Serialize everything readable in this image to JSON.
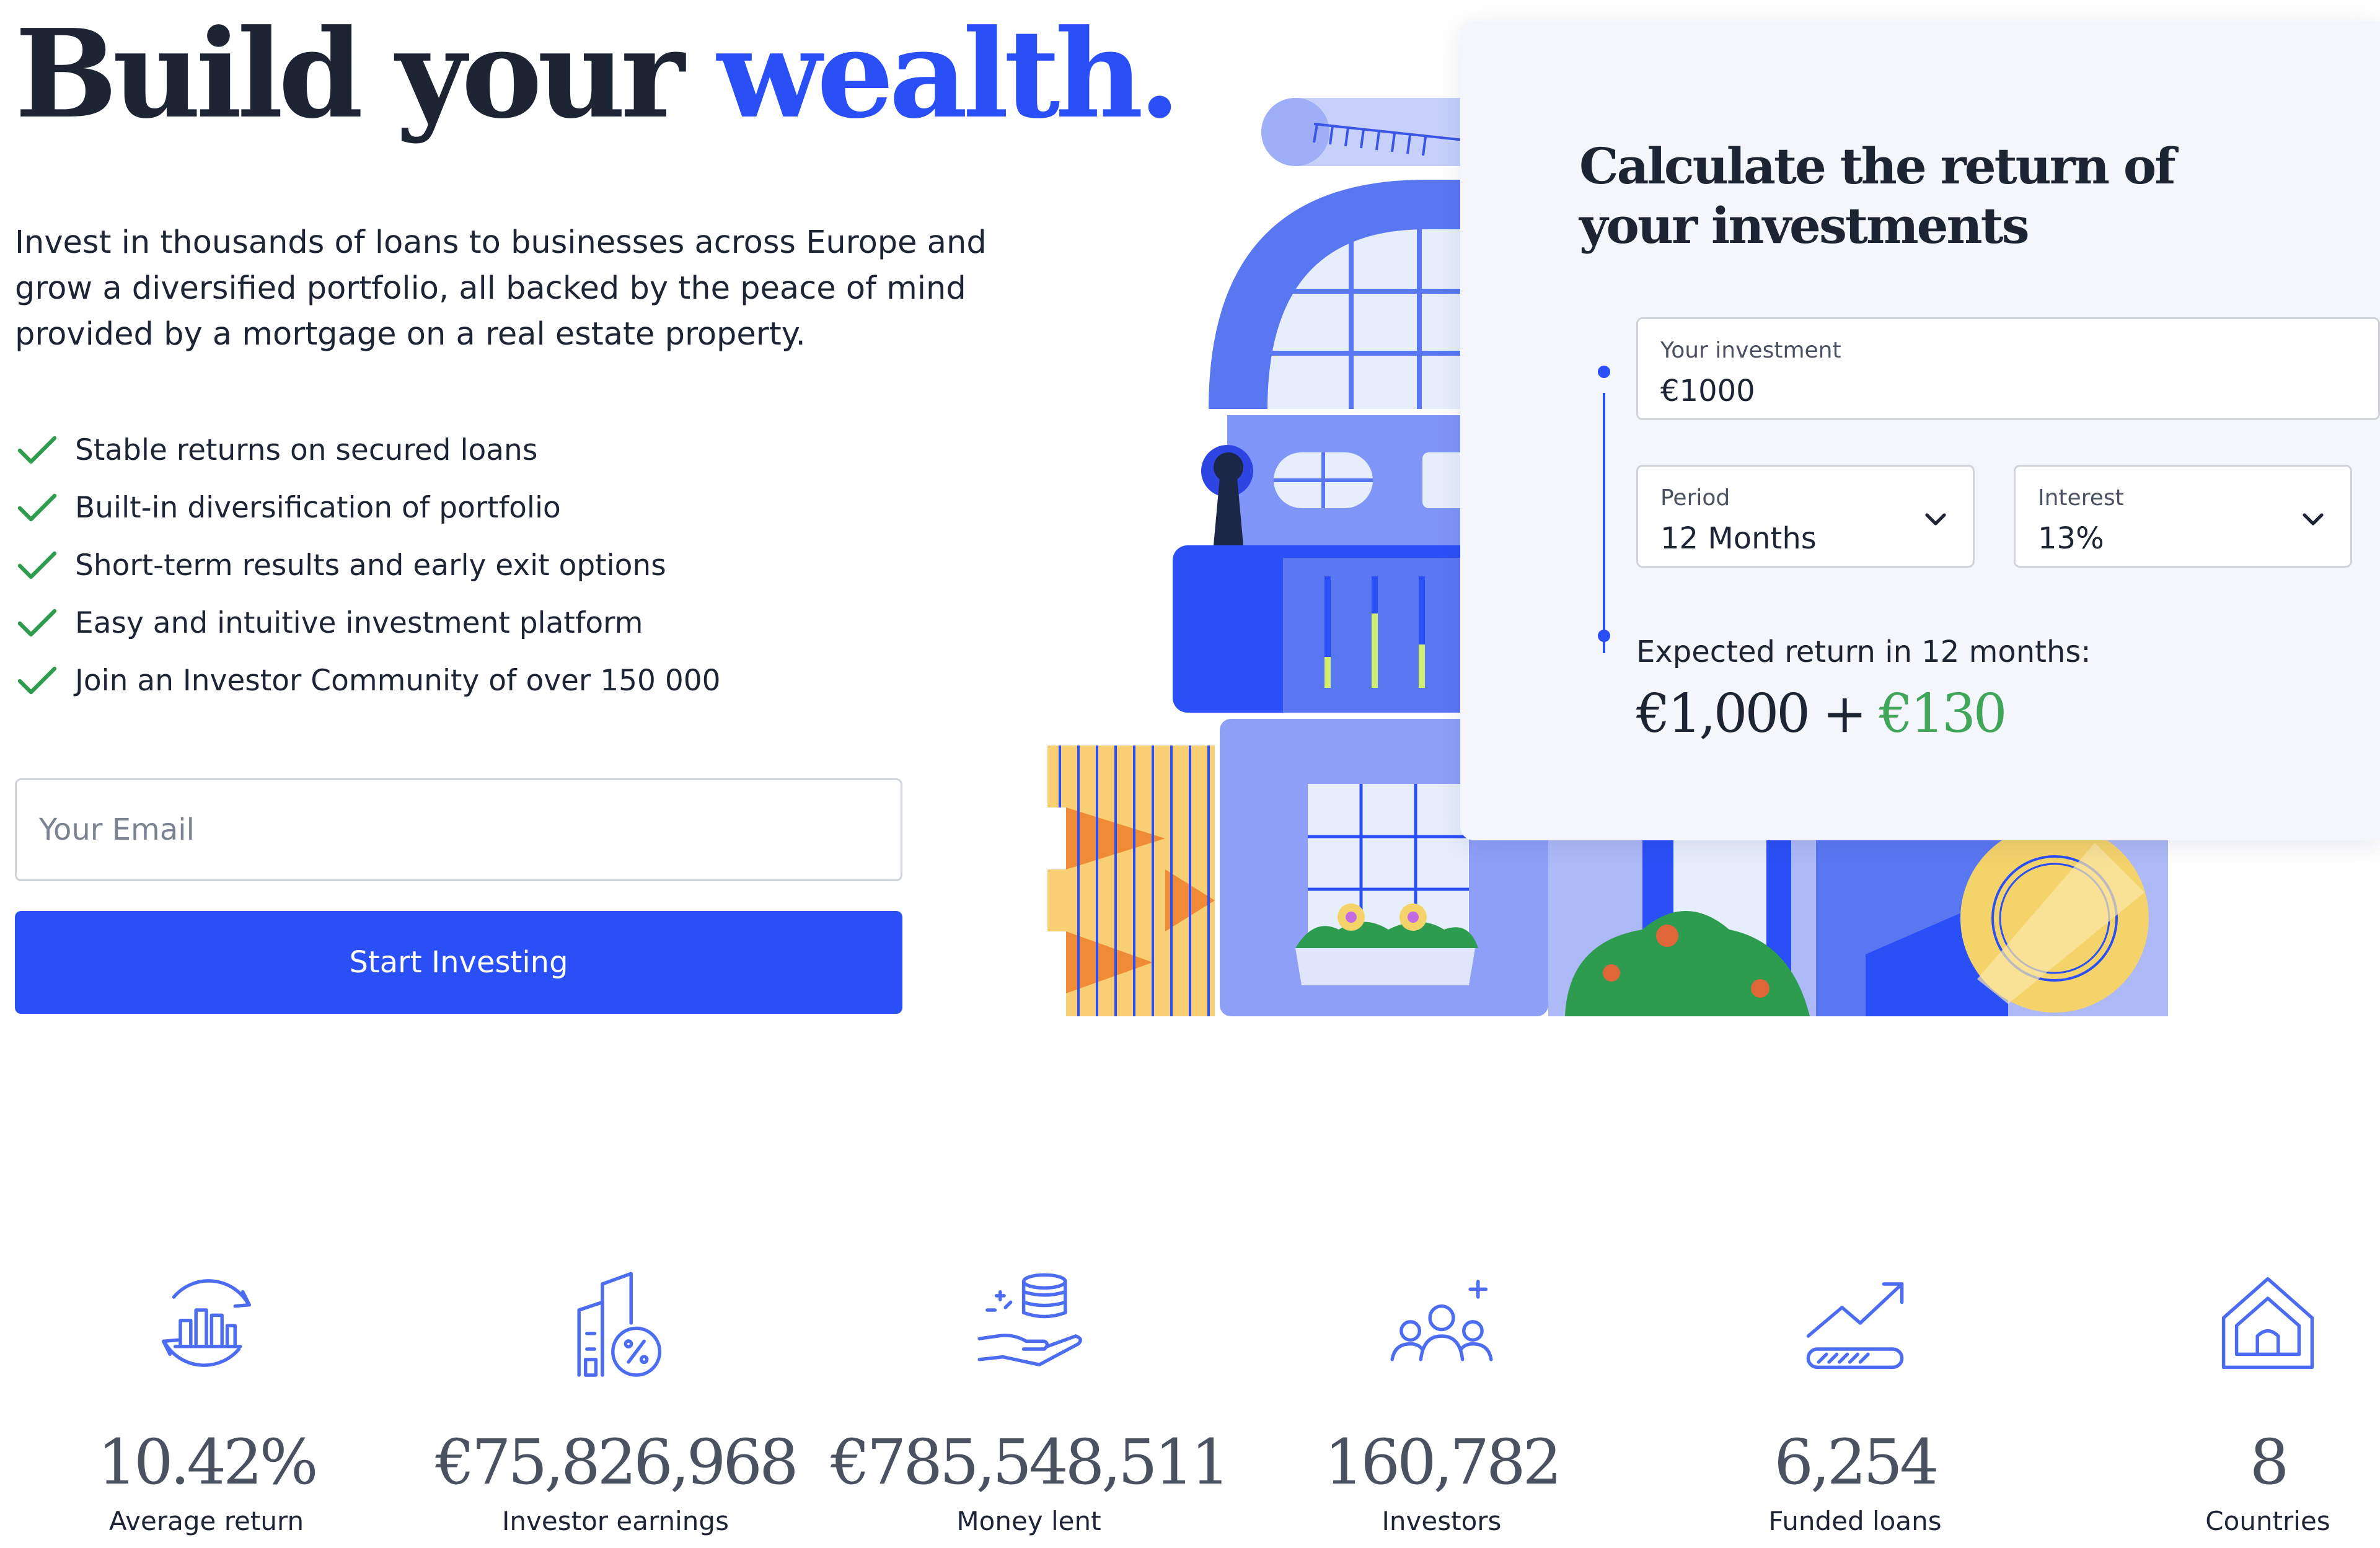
{
  "hero": {
    "title_main": "Build your ",
    "title_accent": "wealth.",
    "description": "Invest in thousands of loans to businesses across Europe and grow a diversified portfolio, all backed by the peace of mind provided by a mortgage on a real estate property.",
    "features": [
      "Stable returns on secured loans",
      "Built-in diversification of portfolio",
      "Short-term results and early exit options",
      "Easy and intuitive investment platform",
      "Join an Investor Community of over 150 000"
    ],
    "email_placeholder": "Your Email",
    "cta_label": "Start Investing",
    "check_icon": "check-icon",
    "accent_color": "#2a4ff6",
    "check_color": "#2e9c4e"
  },
  "calculator": {
    "title": "Calculate the return of your investments",
    "investment": {
      "label": "Your investment",
      "value": "€1000"
    },
    "period": {
      "label": "Period",
      "value": "12 Months"
    },
    "interest": {
      "label": "Interest",
      "value": "13%"
    },
    "expected_label": "Expected return in 12 months:",
    "expected_base": "€1,000",
    "expected_plus": " + ",
    "expected_gain": "€130",
    "gain_color": "#3fa65a"
  },
  "stats": [
    {
      "icon": "return-chart-icon",
      "value": "10.42%",
      "label": "Average return"
    },
    {
      "icon": "earnings-building-icon",
      "value": "€75,826,968",
      "label": "Investor earnings"
    },
    {
      "icon": "hand-coins-icon",
      "value": "€785,548,511",
      "label": "Money lent"
    },
    {
      "icon": "investors-group-icon",
      "value": "160,782",
      "label": "Investors"
    },
    {
      "icon": "funded-loans-icon",
      "value": "6,254",
      "label": "Funded loans"
    },
    {
      "icon": "home-icon",
      "value": "8",
      "label": "Countries"
    }
  ]
}
